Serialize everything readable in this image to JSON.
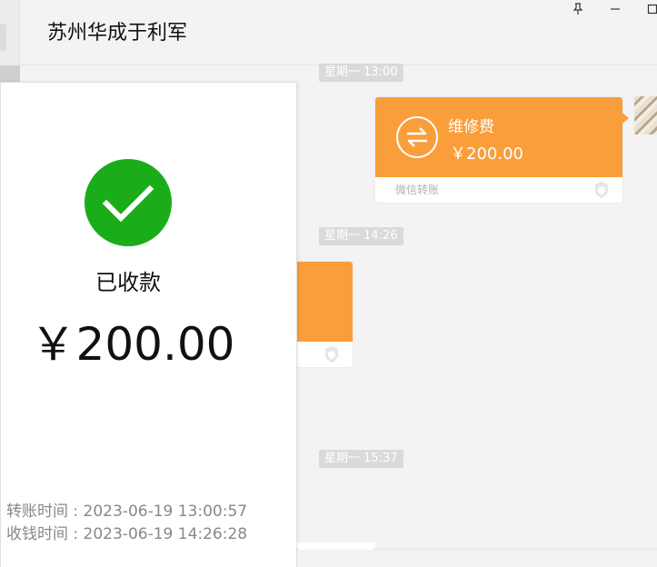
{
  "window": {
    "pin_icon": "pin-icon",
    "minimize_icon": "minimize-icon",
    "maximize_icon": "maximize-icon"
  },
  "header": {
    "title": "苏州华成于利军"
  },
  "messages": [
    {
      "time": "星期一 13:00",
      "card": {
        "title": "维修费",
        "amount": "￥200.00",
        "footer": "微信转账",
        "icon": "transfer-icon",
        "color": "#fa9d3b"
      }
    },
    {
      "time": "星期一 14:26"
    },
    {
      "time": "星期一 15:37"
    }
  ],
  "receipt": {
    "status": "已收款",
    "amount": "￥200.00",
    "transfer_time_label": "转账时间 : ",
    "transfer_time": "2023-06-19 13:00:57",
    "receive_time_label": "收钱时间 : ",
    "receive_time": "2023-06-19 14:26:28",
    "check_color": "#1aad19"
  }
}
